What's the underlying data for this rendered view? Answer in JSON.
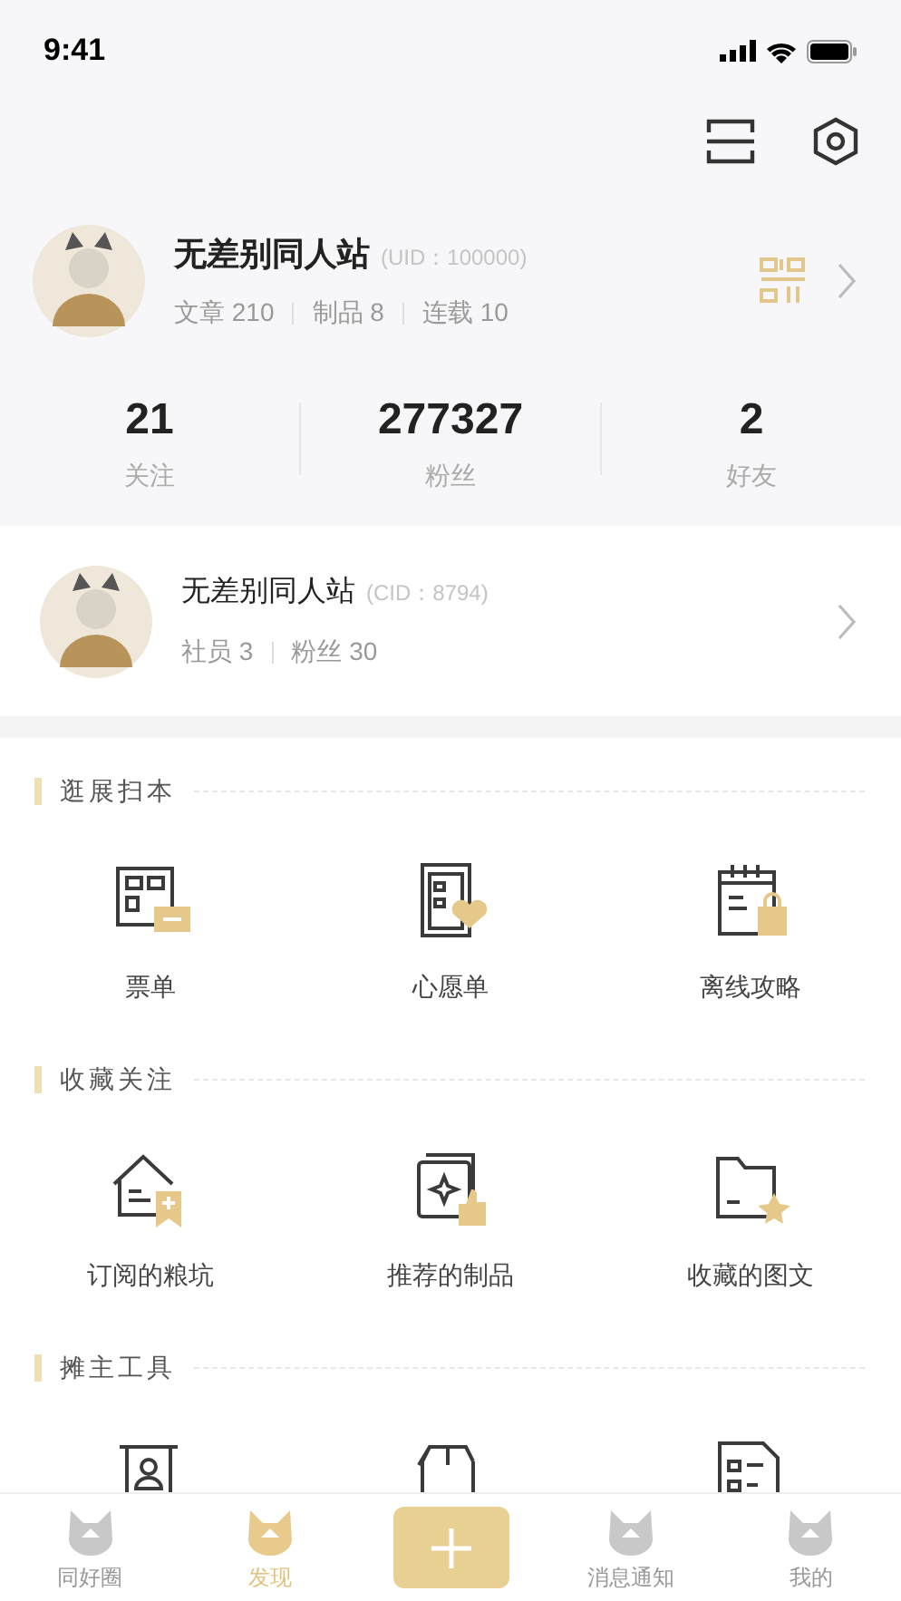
{
  "status_bar": {
    "time": "9:41"
  },
  "profile": {
    "name": "无差别同人站",
    "uid": "(UID：100000)",
    "stats": [
      "文章 210",
      "制品 8",
      "连载 10"
    ]
  },
  "counts": [
    {
      "value": "21",
      "label": "关注"
    },
    {
      "value": "277327",
      "label": "粉丝"
    },
    {
      "value": "2",
      "label": "好友"
    }
  ],
  "club": {
    "name": "无差别同人站",
    "cid": "(CID：8794)",
    "stats": [
      "社员 3",
      "粉丝 30"
    ]
  },
  "sections": [
    {
      "title": "逛展扫本",
      "items": [
        {
          "kind": "ticket",
          "label": "票单"
        },
        {
          "kind": "wish",
          "label": "心愿单"
        },
        {
          "kind": "guide",
          "label": "离线攻略"
        }
      ]
    },
    {
      "title": "收藏关注",
      "items": [
        {
          "kind": "subscribe",
          "label": "订阅的粮坑"
        },
        {
          "kind": "recommend",
          "label": "推荐的制品"
        },
        {
          "kind": "folder",
          "label": "收藏的图文"
        }
      ]
    },
    {
      "title": "摊主工具",
      "items": [
        {
          "kind": "booth"
        },
        {
          "kind": "box"
        },
        {
          "kind": "form"
        }
      ]
    }
  ],
  "tab_bar": [
    {
      "kind": "tab",
      "label": "同好圈",
      "selected": false
    },
    {
      "kind": "tab",
      "label": "发现",
      "selected": true
    },
    {
      "kind": "add"
    },
    {
      "kind": "tab",
      "label": "消息通知",
      "selected": false
    },
    {
      "kind": "tab",
      "label": "我的",
      "selected": false
    }
  ]
}
